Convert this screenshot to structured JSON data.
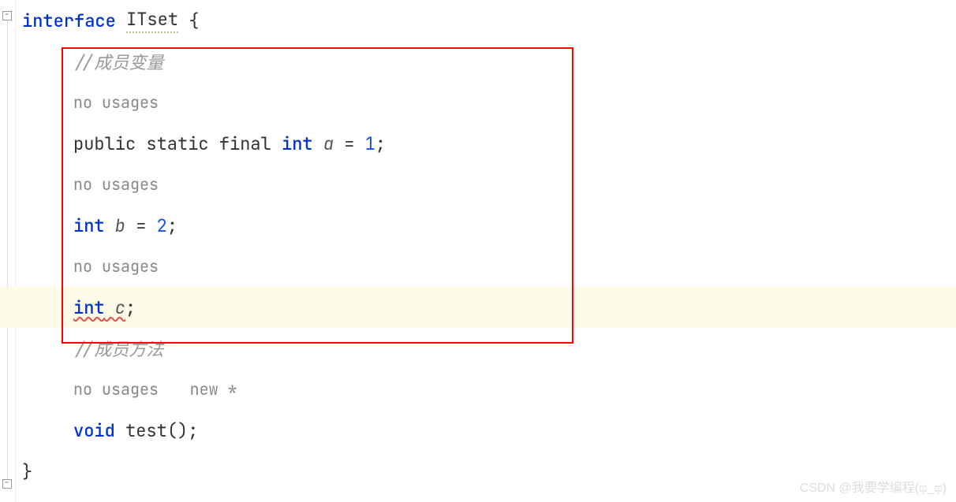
{
  "code": {
    "line1_keyword": "interface",
    "line1_name": "ITset",
    "line1_brace": " {",
    "comment_vars": "//成员变量",
    "inlay_nousages": "no usages",
    "field_a_prefix": "public static final ",
    "type_int": "int",
    "field_a_name": " a ",
    "field_a_assign": "= ",
    "field_a_val": "1",
    "semi": ";",
    "field_b_name": " b ",
    "field_b_assign": "= ",
    "field_b_val": "2",
    "field_c_name": " c",
    "comment_methods": "//成员方法",
    "inlay_new": "new *",
    "void_kw": "void",
    "method_name": " test",
    "method_parens": "()",
    "close_brace": "}"
  },
  "watermark": "CSDN @我要学编程(ಥ_ಥ)"
}
